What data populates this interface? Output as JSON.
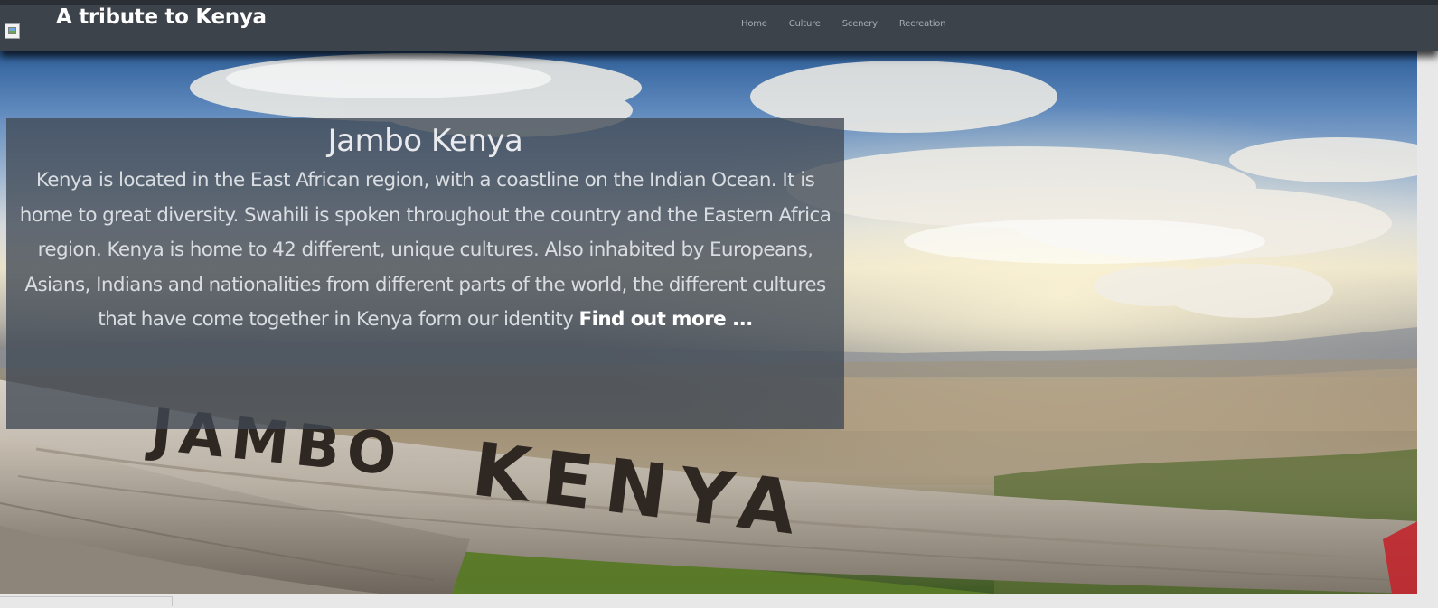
{
  "header": {
    "logo_alt": "",
    "title": "A tribute to Kenya",
    "nav": [
      {
        "label": "Home"
      },
      {
        "label": "Culture"
      },
      {
        "label": "Scenery"
      },
      {
        "label": "Recreation"
      }
    ]
  },
  "hero": {
    "sign_word_1": "JAMBO",
    "sign_word_2": "KENYA",
    "card": {
      "title": "Jambo Kenya",
      "body": "Kenya is located in the East African region, with a coastline on the Indian Ocean. It is home to great diversity. Swahili is spoken throughout the country and the Eastern Africa region. Kenya is home to 42 different, unique cultures. Also inhabited by Europeans, Asians, Indians and nationalities from different parts of the world, the different cultures that have come together in Kenya form our identity",
      "link": "Find out more ..."
    }
  },
  "colors": {
    "navbar": "#3d434a",
    "card_overlay": "#404955",
    "text_light": "#e6e9ec"
  },
  "icons": {
    "broken_image": "broken-image-icon"
  }
}
